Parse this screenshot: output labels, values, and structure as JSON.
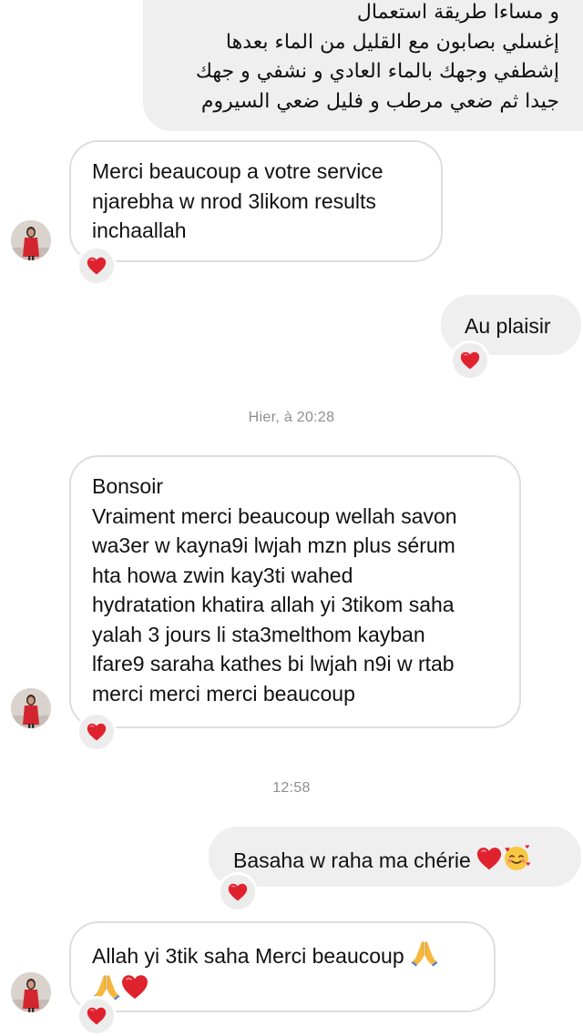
{
  "colors": {
    "incoming_border": "#dedede",
    "outgoing_bg": "#efefef",
    "reaction_heart": "#e0222f",
    "timestamp": "#8e8e8e"
  },
  "messages": [
    {
      "direction": "outgoing",
      "lines": [
        "و مساءا طريقة استعمال",
        "إغسلي بصابون مع القليل من الماء بعدها",
        "إشطفي وجهك بالماء العادي و نشفي و جهك",
        "جيدا ثم ضعي مرطب و فليل ضعي السيروم"
      ]
    },
    {
      "direction": "incoming",
      "lines": [
        "Merci beaucoup a votre service",
        "njarebha w nrod 3likom results",
        "inchaallah"
      ],
      "reaction": "red-heart"
    },
    {
      "direction": "outgoing",
      "lines": [
        "Au plaisir"
      ],
      "reaction": "red-heart"
    },
    {
      "type": "timestamp",
      "text": "Hier, à 20:28"
    },
    {
      "direction": "incoming",
      "lines": [
        "Bonsoir",
        "Vraiment merci beaucoup wellah savon",
        "wa3er w kayna9i lwjah mzn plus sérum",
        "hta howa zwin kay3ti wahed",
        "hydratation khatira allah yi 3tikom saha",
        "yalah 3 jours li sta3melthom kayban",
        "lfare9 saraha kathes bi lwjah n9i w rtab",
        "merci merci merci beaucoup"
      ],
      "reaction": "red-heart"
    },
    {
      "type": "timestamp",
      "text": "12:58"
    },
    {
      "direction": "outgoing",
      "text": "Basaha w raha ma chérie",
      "emojis": [
        "red-heart",
        "smiling-face-with-hearts"
      ],
      "reaction": "red-heart"
    },
    {
      "direction": "incoming",
      "text": "Allah yi 3tik saha Merci beaucoup",
      "emojis": [
        "folded-hands",
        "folded-hands",
        "red-heart"
      ],
      "reaction": "red-heart"
    }
  ]
}
